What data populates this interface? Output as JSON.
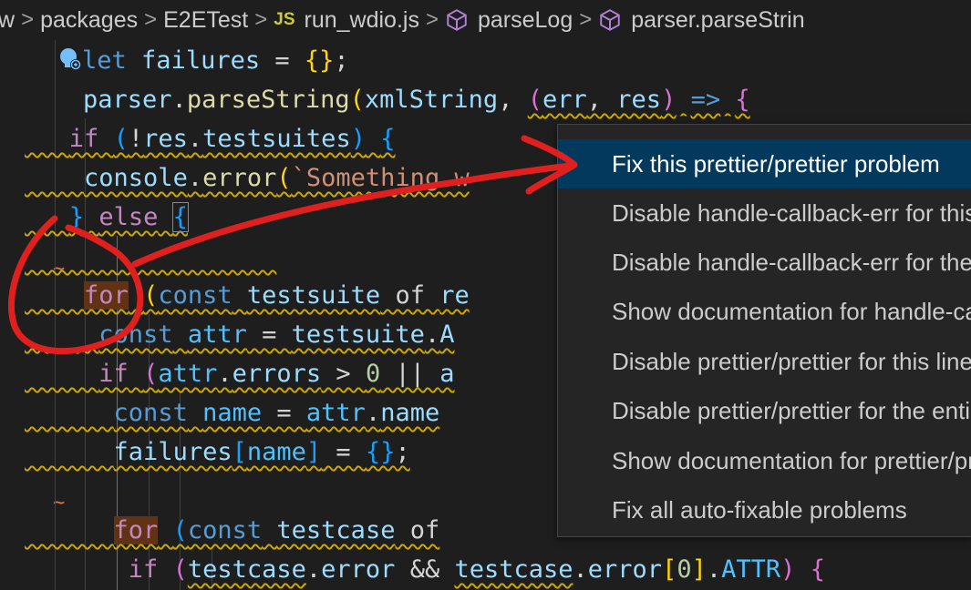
{
  "breadcrumb": {
    "items": [
      "w",
      "packages",
      "E2ETest",
      "run_wdio.js",
      "parseLog",
      "parser.parseStrin"
    ],
    "js_badge": "JS",
    "separator": ">"
  },
  "code": {
    "lines": [
      "let failures = {};",
      "parser.parseString(xmlString, (err, res) => {",
      "if (!res.testsuites) {",
      "console.error(`Something w",
      "} else {",
      "",
      "for (const testsuite of re",
      "const attr = testsuite.A",
      "if (attr.errors > 0 || a",
      "const name = attr.name",
      "failures[name] = {};",
      "",
      "for (const testcase of",
      "if (testcase.error && testcase.error[0].ATTR) {"
    ]
  },
  "gutter": {
    "squiggle_marker": "~"
  },
  "context_menu": {
    "items": [
      {
        "label": "Fix this prettier/prettier problem",
        "selected": true
      },
      {
        "label": "Disable handle-callback-err for this line",
        "selected": false
      },
      {
        "label": "Disable handle-callback-err for the entire file",
        "selected": false
      },
      {
        "label": "Show documentation for handle-callback-err",
        "selected": false
      },
      {
        "label": "Disable prettier/prettier for this line",
        "selected": false
      },
      {
        "label": "Disable prettier/prettier for the entire file",
        "selected": false
      },
      {
        "label": "Show documentation for prettier/prettier",
        "selected": false
      },
      {
        "label": "Fix all auto-fixable problems",
        "selected": false
      }
    ]
  },
  "colors": {
    "editor_bg": "#1e1e1e",
    "menu_bg": "#252526",
    "menu_selected": "#04395e",
    "squiggle": "#cca700",
    "annotation": "#e0201f"
  },
  "icons": {
    "lightbulb": "lightbulb-autofix-icon",
    "symbol": "symbol-method-icon",
    "js_file": "js-file-icon"
  }
}
